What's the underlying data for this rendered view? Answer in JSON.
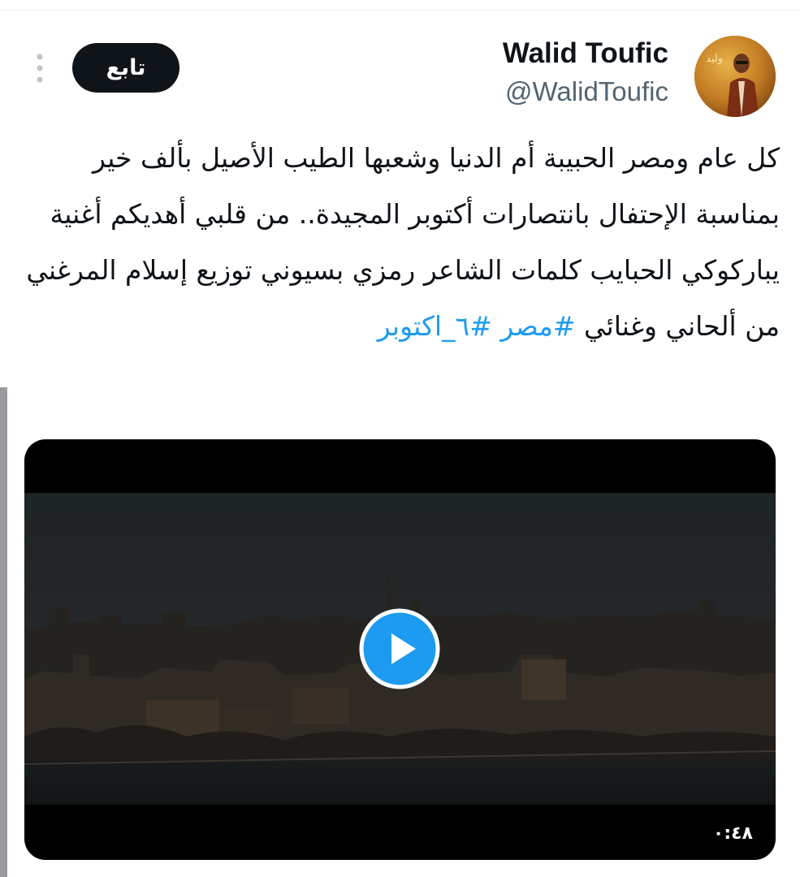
{
  "author": {
    "display_name": "Walid Toufic",
    "handle": "@WalidToufic",
    "avatar_text": "وليد",
    "avatar_icon": "avatar-photo"
  },
  "follow_button": {
    "label": "تابع"
  },
  "more_icon": "more-vertical-icon",
  "tweet": {
    "text": "كل عام ومصر الحبيبة أم الدنيا وشعبها الطيب الأصيل بألف خير بمناسبة الإحتفال بانتصارات أكتوبر المجيدة.. من قلبي أهديكم أغنية يباركوكي الحبايب كلمات الشاعر رمزي بسيوني توزيع إسلام المرغني من ألحاني وغنائي",
    "hashtags": [
      "#مصر",
      "#٦_اكتوبر"
    ]
  },
  "video": {
    "duration": "٠:٤٨",
    "play_icon": "play-icon"
  },
  "colors": {
    "link": "#1d9bf0",
    "button_bg": "#0f1419",
    "text": "#0f1419",
    "secondary_text": "#536471"
  }
}
